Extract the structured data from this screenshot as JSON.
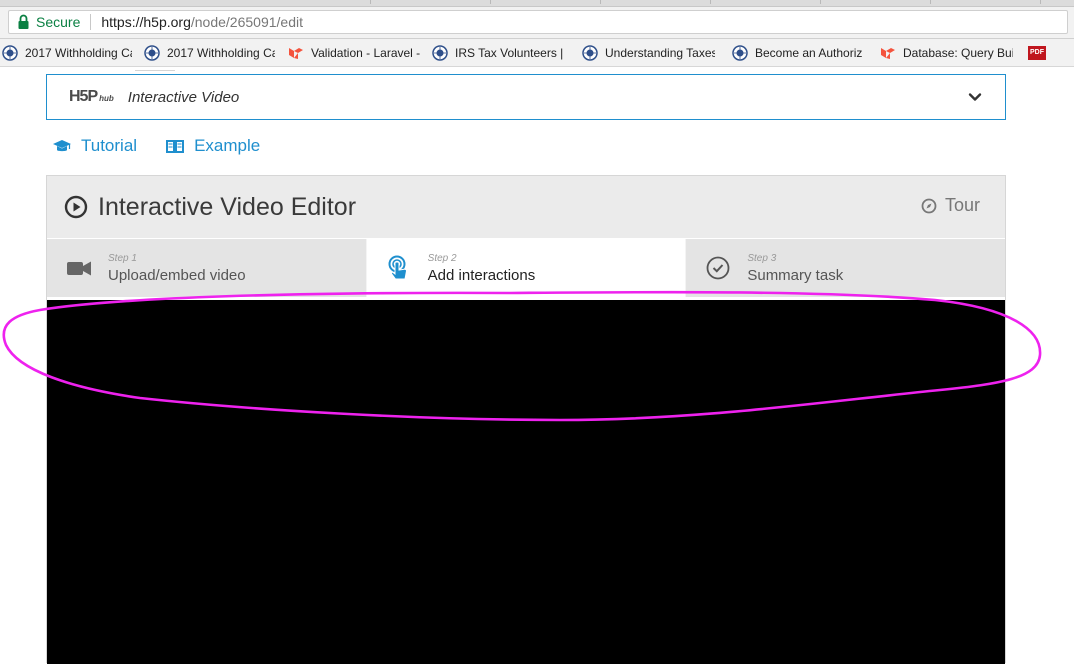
{
  "browser": {
    "secure_label": "Secure",
    "url_host": "https://h5p.org",
    "url_path": "/node/265091/edit",
    "bookmarks": [
      {
        "label": "2017 Withholding Ca",
        "icon": "irs-seal-icon"
      },
      {
        "label": "2017 Withholding Ca",
        "icon": "irs-seal-icon"
      },
      {
        "label": "Validation - Laravel -",
        "icon": "laravel-icon"
      },
      {
        "label": "IRS Tax Volunteers | I",
        "icon": "irs-seal-icon"
      },
      {
        "label": "Understanding Taxes",
        "icon": "irs-seal-icon"
      },
      {
        "label": "Become an Authoriz",
        "icon": "irs-seal-icon"
      },
      {
        "label": "Database: Query Buil",
        "icon": "laravel-icon"
      },
      {
        "label": "PDF",
        "icon": "pdf-icon"
      }
    ]
  },
  "content_type": {
    "logo_main": "H5P",
    "logo_sub": "hub",
    "selected": "Interactive Video"
  },
  "help_links": {
    "tutorial": "Tutorial",
    "example": "Example"
  },
  "editor": {
    "title": "Interactive Video Editor",
    "tour": "Tour",
    "steps": [
      {
        "num": "Step 1",
        "label": "Upload/embed video",
        "icon": "video-camera-icon",
        "active": false
      },
      {
        "num": "Step 2",
        "label": "Add interactions",
        "icon": "tap-hand-icon",
        "active": true
      },
      {
        "num": "Step 3",
        "label": "Summary task",
        "icon": "check-circle-icon",
        "active": false
      }
    ]
  },
  "colors": {
    "accent": "#1f8fce",
    "annotation": "#ee22ee",
    "secure": "#0b8043"
  }
}
